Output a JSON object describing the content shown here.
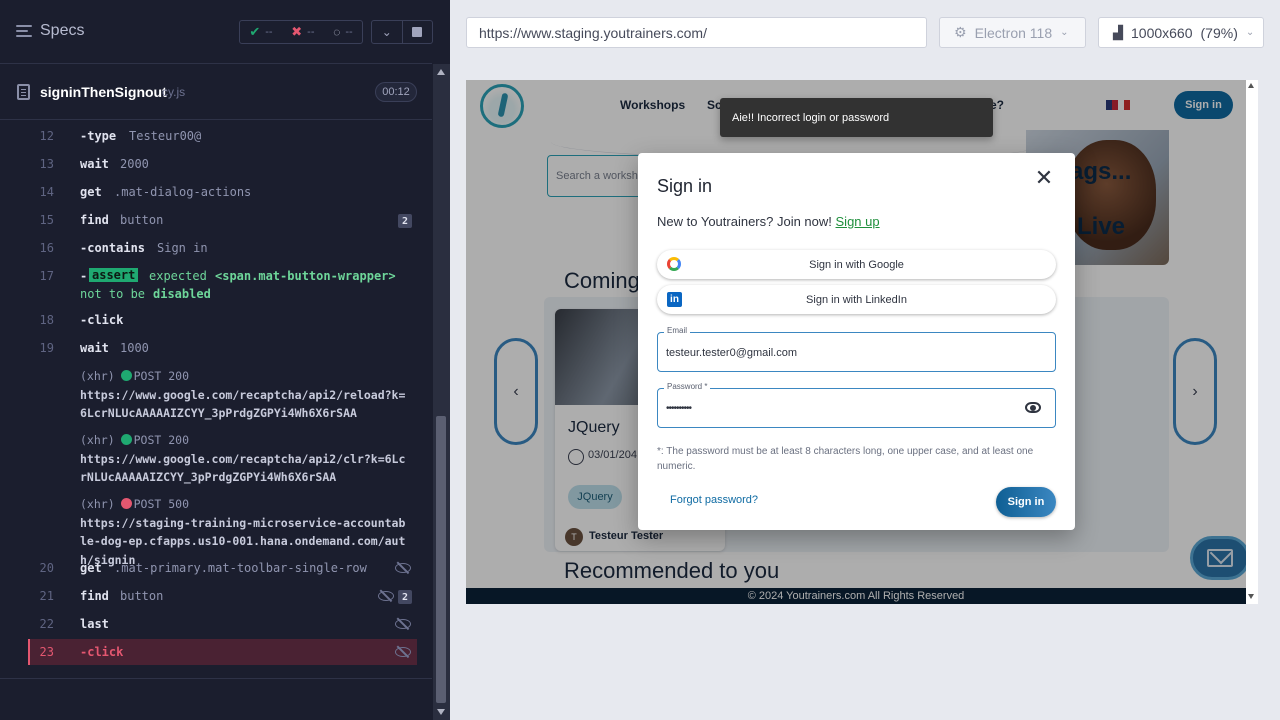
{
  "reporter": {
    "specs_label": "Specs",
    "stats": {
      "passed": "--",
      "failed": "--",
      "pending": "--"
    },
    "spec_name": "signinThenSignout",
    "spec_ext": "cy.js",
    "spec_time": "00:12",
    "commands": [
      {
        "num": "12",
        "name": "-type",
        "msg": "Testeur00@"
      },
      {
        "num": "13",
        "name": "wait",
        "msg": "2000"
      },
      {
        "num": "14",
        "name": "get",
        "msg": ".mat-dialog-actions"
      },
      {
        "num": "15",
        "name": "find",
        "msg": "button",
        "count": "2"
      },
      {
        "num": "16",
        "name": "-contains",
        "msg": "Sign in"
      },
      {
        "num": "17",
        "name": "-",
        "assert_tag": "assert",
        "msg_a": "expected",
        "msg_b": "<span.mat-button-wrapper>",
        "msg_c": "not to be",
        "msg_d": "disabled"
      },
      {
        "num": "18",
        "name": "-click",
        "msg": ""
      },
      {
        "num": "19",
        "name": "wait",
        "msg": "1000"
      },
      {
        "num": "20",
        "name": "get",
        "msg": ".mat-primary.mat-toolbar-single-row"
      },
      {
        "num": "21",
        "name": "find",
        "msg": "button",
        "count": "2"
      },
      {
        "num": "22",
        "name": "last",
        "msg": ""
      },
      {
        "num": "23",
        "name": "-click",
        "msg": ""
      }
    ],
    "xhr": [
      {
        "prefix": "(xhr)",
        "status": "POST 200",
        "status_color": "#1fa971",
        "url": "https://www.google.com/recaptcha/api2/reload?k=6LcrNLUcAAAAAIZCYY_3pPrdgZGPYi4Wh6X6rSAA"
      },
      {
        "prefix": "(xhr)",
        "status": "POST 200",
        "status_color": "#1fa971",
        "url": "https://www.google.com/recaptcha/api2/clr?k=6LcrNLUcAAAAAIZCYY_3pPrdgZGPYi4Wh6X6rSAA"
      },
      {
        "prefix": "(xhr)",
        "status": "POST 500",
        "status_color": "#e45770",
        "url": "https://staging-training-microservice-accountable-dog-ep.cfapps.us10-001.hana.ondemand.com/auth/signin"
      }
    ]
  },
  "browser": {
    "url": "https://www.staging.youtrainers.com/",
    "browser_name": "Electron 118",
    "viewport": "1000x660",
    "zoom": "(79%)"
  },
  "site": {
    "nav_workshops": "Workshops",
    "nav_partial": "Sc",
    "nav_partial2": "e?",
    "nav_signin": "Sign in",
    "hero_text1": "ags...",
    "hero_text2": "Live",
    "search_placeholder": "Search a worksh",
    "coming_title": "Coming",
    "card_title": "JQuery",
    "card_date": "03/01/204",
    "card_tag": "JQuery",
    "card_avatar": "T",
    "card_author": "Testeur Tester",
    "recommended_title": "Recommended to you",
    "footer": "© 2024 Youtrainers.com All Rights Reserved"
  },
  "dialog": {
    "title": "Sign in",
    "join_text": "New to Youtrainers? Join now!",
    "signup_link": "Sign up",
    "google_button": "Sign in with Google",
    "linkedin_button": "Sign in with LinkedIn",
    "email_label": "Email",
    "email_value": "testeur.tester0@gmail.com",
    "password_label": "Password *",
    "password_value": "••••••••••",
    "hint": "*: The password must be at least 8 characters long, one upper case, and at least one numeric.",
    "forgot_link": "Forgot password?",
    "signin_button": "Sign in"
  },
  "toast": {
    "message": "Aie!! Incorrect login or password"
  }
}
